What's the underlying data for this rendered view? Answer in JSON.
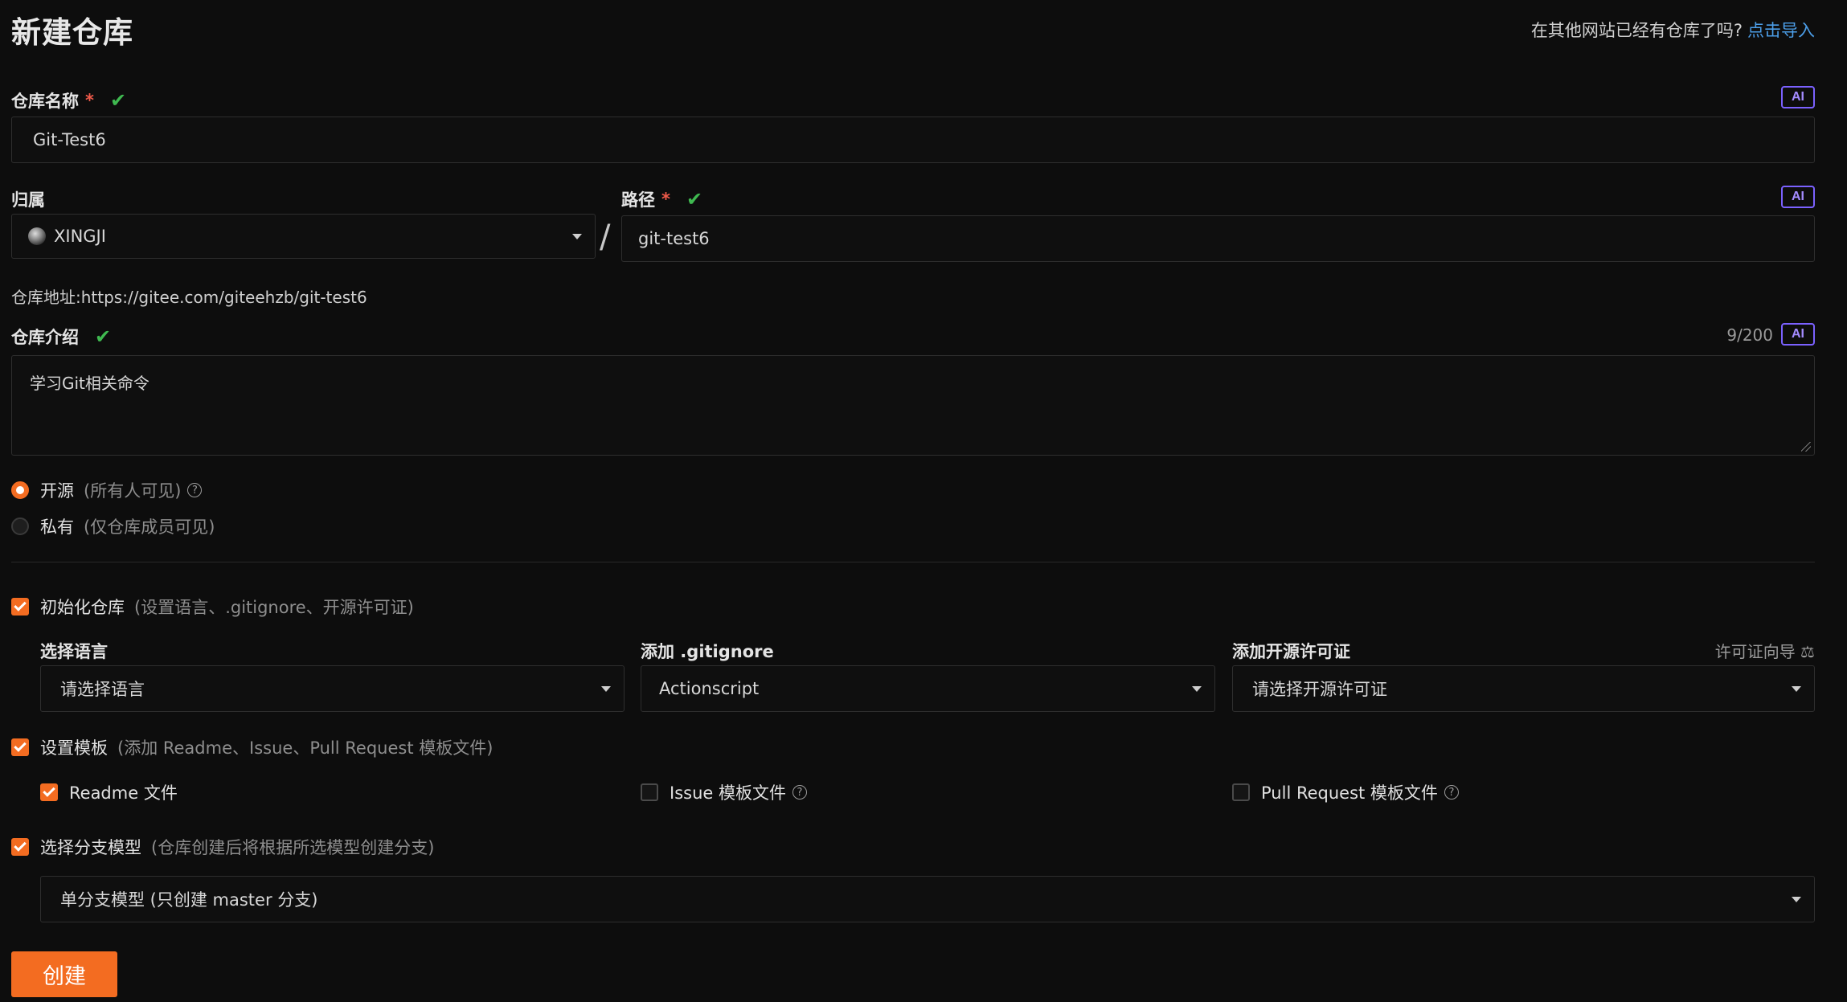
{
  "page": {
    "title": "新建仓库",
    "import_prompt": "在其他网站已经有仓库了吗?",
    "import_link": "点击导入"
  },
  "repo_name": {
    "label": "仓库名称",
    "required": "*",
    "value": "Git-Test6",
    "ai": "AI"
  },
  "owner": {
    "label": "归属",
    "value": "XINGJI"
  },
  "path": {
    "label": "路径",
    "required": "*",
    "value": "git-test6",
    "ai": "AI",
    "separator": "/"
  },
  "address": "仓库地址:https://gitee.com/giteehzb/git-test6",
  "description": {
    "label": "仓库介绍",
    "value": "学习Git相关命令",
    "counter": "9/200",
    "ai": "AI"
  },
  "visibility": {
    "public_label": "开源",
    "public_hint": "(所有人可见)",
    "private_label": "私有",
    "private_hint": "(仅仓库成员可见)",
    "help": "?"
  },
  "init": {
    "label": "初始化仓库",
    "hint": "(设置语言、.gitignore、开源许可证)",
    "language_label": "选择语言",
    "language_value": "请选择语言",
    "gitignore_label": "添加 .gitignore",
    "gitignore_value": "Actionscript",
    "license_label": "添加开源许可证",
    "license_value": "请选择开源许可证",
    "license_guide": "许可证向导 ⚖"
  },
  "template": {
    "label": "设置模板",
    "hint": "(添加 Readme、Issue、Pull Request 模板文件)",
    "readme": "Readme 文件",
    "issue": "Issue 模板文件",
    "pr": "Pull Request 模板文件",
    "help": "?"
  },
  "branch": {
    "label": "选择分支模型",
    "hint": "(仓库创建后将根据所选模型创建分支)",
    "value": "单分支模型 (只创建 master 分支)"
  },
  "submit": "创建",
  "colors": {
    "accent": "#f36c21",
    "link": "#4c9ee8",
    "success": "#3fb950",
    "ai": "#7b61ff",
    "background": "#0d0d0d"
  }
}
